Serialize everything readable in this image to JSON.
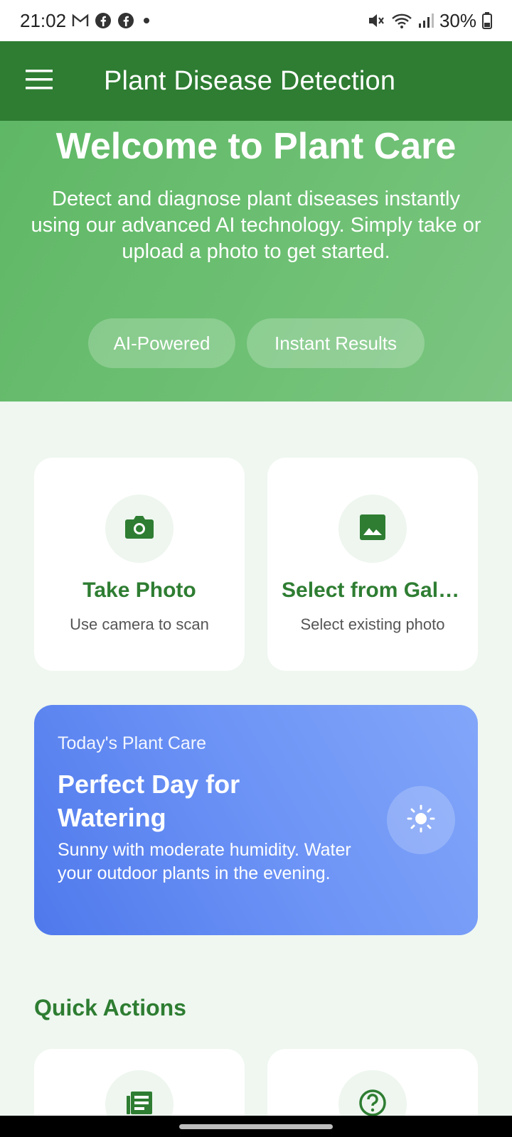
{
  "status_bar": {
    "time": "21:02",
    "battery": "30%",
    "notification_icons": [
      "gmail-icon",
      "facebook-icon",
      "facebook-icon",
      "dot-icon"
    ],
    "system_icons": [
      "mute-icon",
      "wifi-icon",
      "signal-icon",
      "battery-icon"
    ]
  },
  "app_bar": {
    "title": "Plant Disease Detection",
    "menu_icon": "hamburger-menu-icon",
    "color": "#2e7d32"
  },
  "hero": {
    "title": "Welcome to Plant Care",
    "description": "Detect and diagnose plant diseases instantly using our advanced AI technology. Simply take or upload a photo to get started.",
    "chips": [
      "AI-Powered",
      "Instant Results"
    ]
  },
  "actions": {
    "take_photo": {
      "title": "Take Photo",
      "subtitle": "Use camera to scan",
      "icon": "camera-icon"
    },
    "gallery": {
      "title": "Select from Gallery",
      "subtitle": "Select existing photo",
      "icon": "image-icon"
    }
  },
  "weather": {
    "label": "Today's Plant Care",
    "title": "Perfect Day for Watering",
    "description": "Sunny with moderate humidity. Water your outdoor plants in the evening.",
    "icon": "sun-icon"
  },
  "quick_actions": {
    "title": "Quick Actions",
    "items": [
      {
        "icon": "article-icon"
      },
      {
        "icon": "help-icon"
      }
    ]
  },
  "colors": {
    "primary": "#2e7d32",
    "hero_green": "#6cbf72",
    "weather_blue": "#6e95f6",
    "background": "#eff7f0"
  }
}
